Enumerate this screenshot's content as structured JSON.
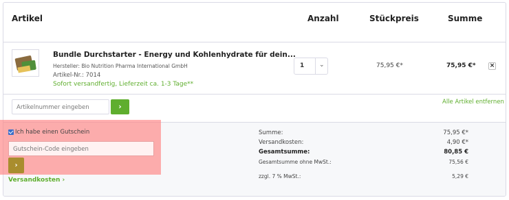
{
  "header": {
    "artikel": "Artikel",
    "anzahl": "Anzahl",
    "stueckpreis": "Stückpreis",
    "summe": "Summe"
  },
  "item": {
    "image_icon": "product-image",
    "title": "Bundle Durchstarter - Energy und Kohlenhydrate für dein...",
    "manufacturer": "Hersteller: Bio Nutrition Pharma International GmbH",
    "article_no": "Artikel-Nr.: 7014",
    "delivery": "Sofort versandfertig, Lieferzeit ca. 1-3 Tage**",
    "quantity": "1",
    "chevron": "⌄",
    "unit_price": "75,95 €*",
    "line_total": "75,95 €*",
    "remove": "×"
  },
  "add_article": {
    "placeholder": "Artikelnummer eingeben",
    "button": "›",
    "remove_all": "Alle Artikel entfernen"
  },
  "voucher": {
    "checkbox_checked": true,
    "checkbox_label": "Ich habe einen Gutschein",
    "placeholder": "Gutschein-Code eingeben",
    "button": "›",
    "highlight_color": "#ff8282"
  },
  "shipping_link": "Versandkosten ›",
  "totals": [
    {
      "label": "Summe:",
      "value": "75,95 €*"
    },
    {
      "label": "Versandkosten:",
      "value": "4,90 €*"
    },
    {
      "label": "Gesamtsumme:",
      "value": "80,85 €"
    },
    {
      "label": "Gesamtsumme ohne MwSt.:",
      "value": "75,56 €"
    },
    {
      "label": "zzgl. 7 % MwSt.:",
      "value": "5,29 €"
    }
  ],
  "colors": {
    "accent": "#5fae2e",
    "voucher_button": "#a98d2e",
    "border": "#dadae5"
  }
}
